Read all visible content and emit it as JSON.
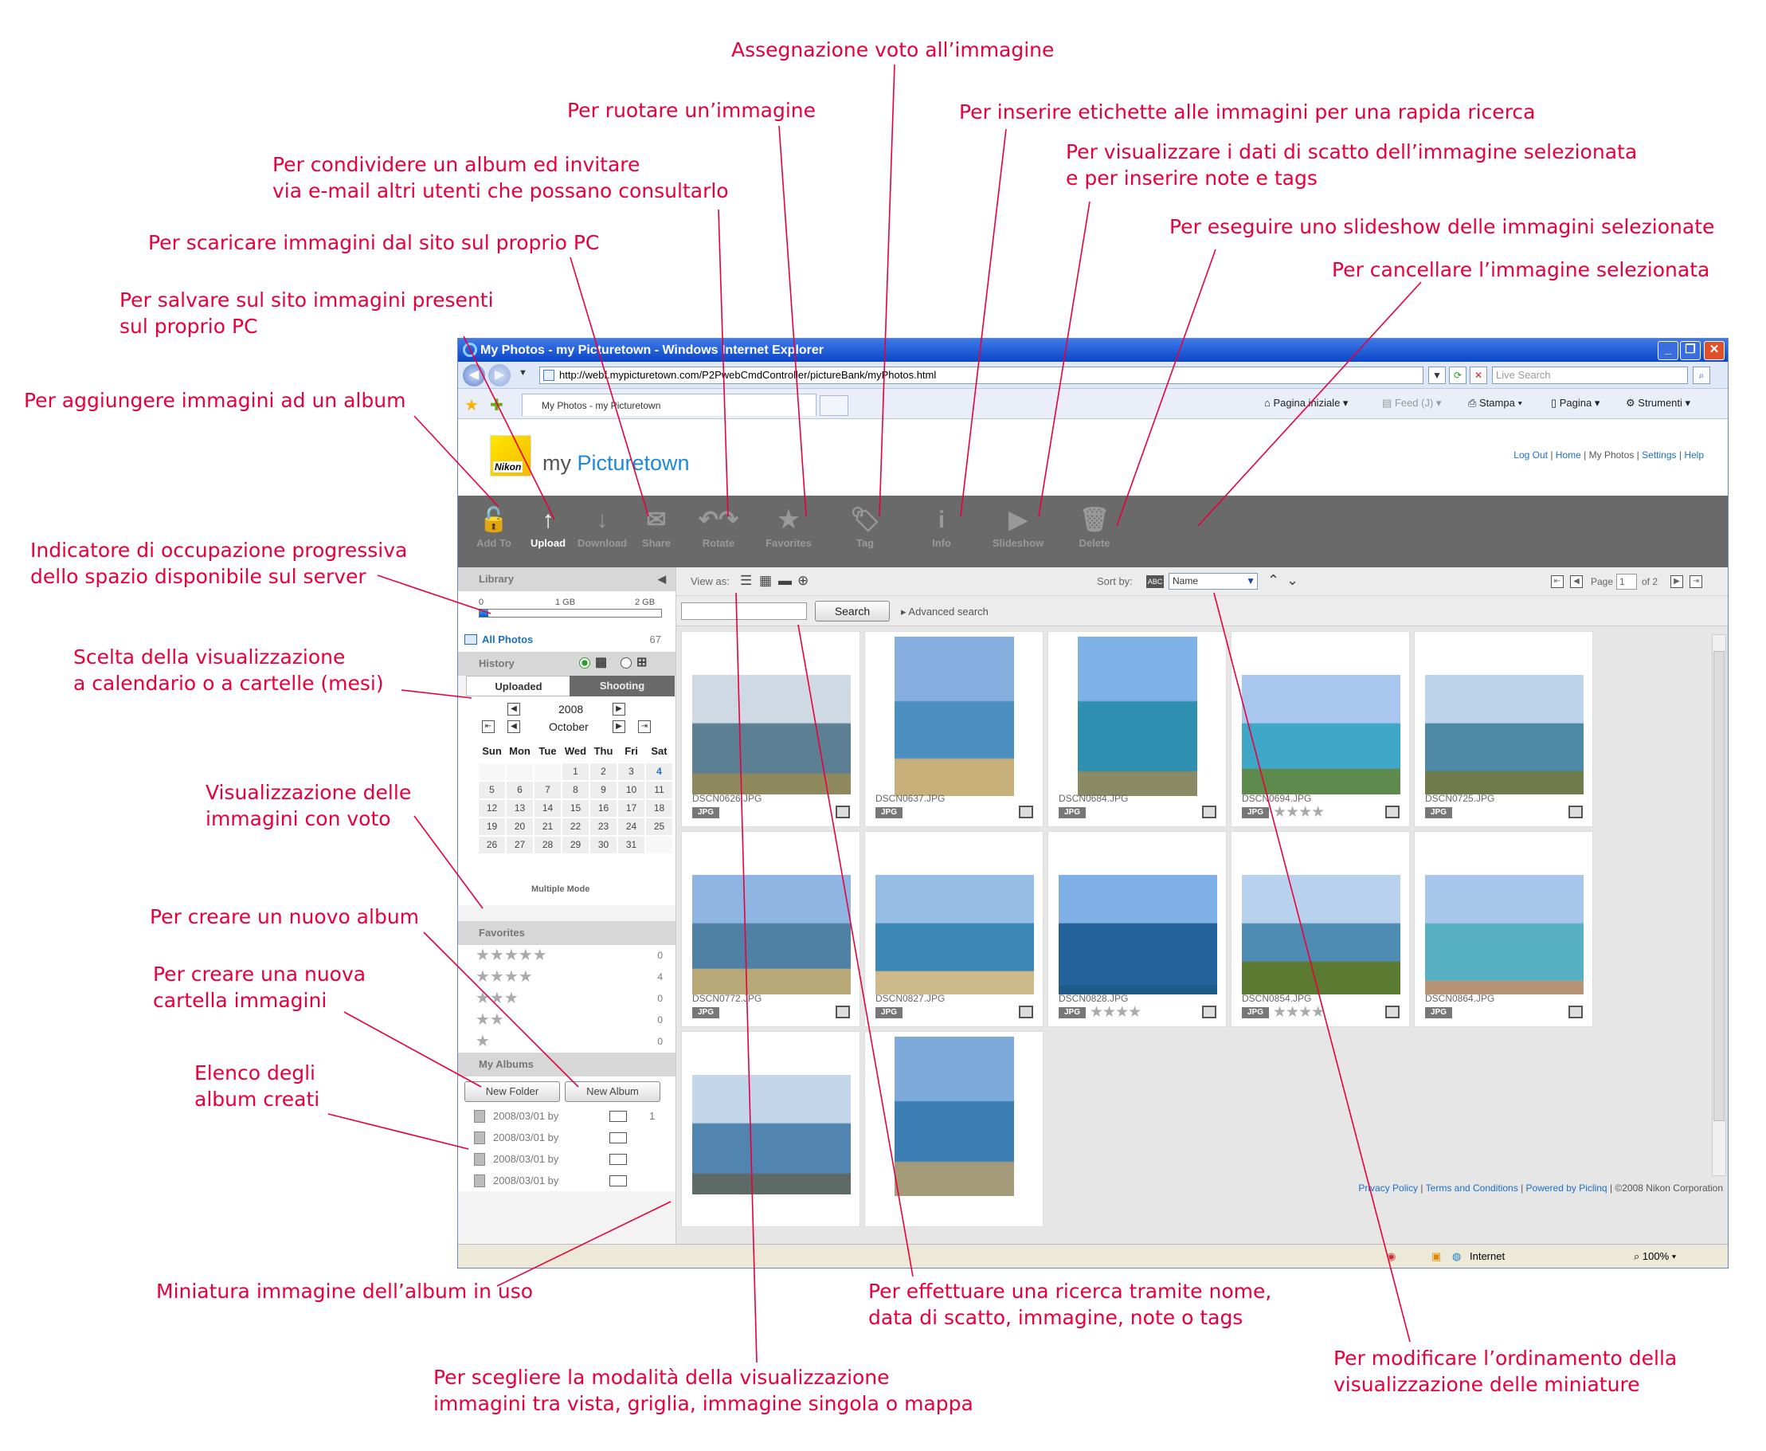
{
  "annotations": {
    "rating": "Assegnazione voto all’immagine",
    "rotate": "Per ruotare un’immagine",
    "tags": "Per inserire etichette alle immagini per una rapida ricerca",
    "share": "Per condividere un album ed invitare\nvia e-mail altri utenti che possano consultarlo",
    "info": "Per visualizzare i dati di scatto dell’immagine selezionata\ne per inserire note e tags",
    "download": "Per scaricare immagini dal sito sul proprio PC",
    "slideshow": "Per eseguire uno slideshow delle immagini selezionate",
    "upload": "Per salvare sul sito immagini presenti\nsul proprio PC",
    "delete": "Per cancellare l’immagine selezionata",
    "addto": "Per aggiungere immagini ad un album",
    "quota": "Indicatore di occupazione progressiva\ndello spazio disponibile sul server",
    "calendar": "Scelta della visualizzazione\na calendario o a cartelle (mesi)",
    "favorites": "Visualizzazione delle\nimmagini con voto",
    "newalbum": "Per creare un nuovo album",
    "newfolder": "Per creare una nuova\ncartella immagini",
    "albums": "Elenco degli\nalbum creati",
    "thumb": "Miniatura immagine dell’album in uso",
    "search": "Per effettuare una ricerca tramite nome,\ndata di scatto, immagine, note o tags",
    "sort": "Per modificare l’ordinamento della\nvisualizzazione delle miniature",
    "viewmode": "Per scegliere la modalità della visualizzazione\nimmagini tra vista, griglia, immagine singola o mappa"
  },
  "browser": {
    "title": "My Photos - my Picturetown - Windows Internet Explorer",
    "url": "http://webf.mypicturetown.com/P2PwebCmdController/pictureBank/myPhotos.html",
    "search_placeholder": "Live Search",
    "tab": "My Photos - my Picturetown",
    "home": "Pagina iniziale",
    "feed": "Feed (J)",
    "print": "Stampa",
    "page": "Pagina",
    "tools": "Strumenti",
    "status_zone": "Internet",
    "zoom": "100%"
  },
  "app": {
    "logo_text": "Nikon",
    "brand_a": "my ",
    "brand_b": "Picturetown",
    "links": [
      "Log Out",
      "Home",
      "My Photos",
      "Settings",
      "Help"
    ],
    "toolbar": [
      "Add To",
      "Upload",
      "Download",
      "Share",
      "Rotate",
      "Favorites",
      "Tag",
      "Info",
      "Slideshow",
      "Delete"
    ],
    "library": "Library",
    "quota_labels": [
      "0",
      "1 GB",
      "2 GB"
    ],
    "quota_fraction": 0.05,
    "all_photos": "All Photos",
    "all_count": "67",
    "history": "History",
    "tab_uploaded": "Uploaded",
    "tab_shooting": "Shooting",
    "year": "2008",
    "month": "October",
    "weekdays": [
      "Sun",
      "Mon",
      "Tue",
      "Wed",
      "Thu",
      "Fri",
      "Sat"
    ],
    "weeks": [
      [
        "",
        "",
        "",
        "1",
        "2",
        "3",
        "4"
      ],
      [
        "5",
        "6",
        "7",
        "8",
        "9",
        "10",
        "11"
      ],
      [
        "12",
        "13",
        "14",
        "15",
        "16",
        "17",
        "18"
      ],
      [
        "19",
        "20",
        "21",
        "22",
        "23",
        "24",
        "25"
      ],
      [
        "26",
        "27",
        "28",
        "29",
        "30",
        "31",
        ""
      ]
    ],
    "multiple_mode": "Multiple Mode",
    "favorites": "Favorites",
    "fav_rows": [
      {
        "stars": "★★★★★",
        "count": "0"
      },
      {
        "stars": "★★★★",
        "count": "4"
      },
      {
        "stars": "★★★",
        "count": "0"
      },
      {
        "stars": "★★",
        "count": "0"
      },
      {
        "stars": "★",
        "count": "0"
      }
    ],
    "my_albums": "My Albums",
    "new_folder": "New Folder",
    "new_album": "New Album",
    "albums": [
      "2008/03/01 by",
      "2008/03/01 by",
      "2008/03/01 by",
      "2008/03/01 by"
    ],
    "album_first_count": "1",
    "view_as": "View as:",
    "sort_by": "Sort by:",
    "sort_value": "Name",
    "page_label": "Page",
    "page_value": "1",
    "page_of": "of 2",
    "search_btn": "Search",
    "advanced": "Advanced search",
    "photos": [
      {
        "name": "DSCN0626.JPG",
        "type": "JPG",
        "rating": ""
      },
      {
        "name": "DSCN0637.JPG",
        "type": "JPG",
        "rating": ""
      },
      {
        "name": "DSCN0684.JPG",
        "type": "JPG",
        "rating": ""
      },
      {
        "name": "DSCN0694.JPG",
        "type": "JPG",
        "rating": "★★★★"
      },
      {
        "name": "DSCN0725.JPG",
        "type": "JPG",
        "rating": ""
      },
      {
        "name": "DSCN0772.JPG",
        "type": "JPG",
        "rating": ""
      },
      {
        "name": "DSCN0827.JPG",
        "type": "JPG",
        "rating": ""
      },
      {
        "name": "DSCN0828.JPG",
        "type": "JPG",
        "rating": "★★★★"
      },
      {
        "name": "DSCN0854.JPG",
        "type": "JPG",
        "rating": "★★★★"
      },
      {
        "name": "DSCN0864.JPG",
        "type": "JPG",
        "rating": ""
      },
      {
        "name": "",
        "type": "",
        "rating": ""
      },
      {
        "name": "",
        "type": "",
        "rating": ""
      }
    ],
    "footer": [
      "Privacy Policy",
      "Terms and Conditions",
      "Powered by Piclinq",
      "©2008 Nikon Corporation"
    ]
  },
  "colors": {
    "annotation": "#e8003d",
    "toolbar": "#6a6a6a",
    "link": "#1c6fc7",
    "titlebar": "#0a46c8"
  }
}
